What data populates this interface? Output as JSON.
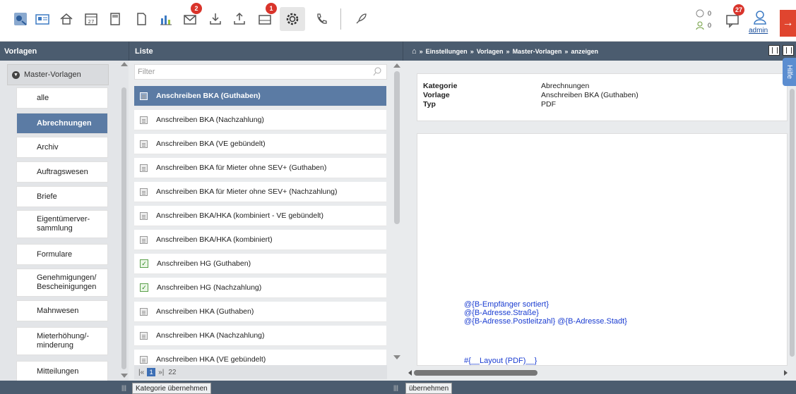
{
  "toolbar": {
    "icons": [
      "dashboard-icon",
      "contacts-icon",
      "home-icon",
      "calendar-icon",
      "calculator-icon",
      "documents-icon",
      "statistics-icon",
      "mail-icon",
      "download-icon",
      "upload-icon",
      "inbox-icon",
      "settings-icon",
      "phone-icon",
      "rocket-icon"
    ],
    "calendar_day": "27",
    "mail_badge": "2",
    "inbox_badge": "1",
    "user_count_1": "0",
    "user_count_2": "0",
    "messages_badge": "27",
    "user_label": "admin"
  },
  "headers": {
    "vorlagen": "Vorlagen",
    "liste": "Liste",
    "breadcrumb": [
      "Einstellungen",
      "Vorlagen",
      "Master-Vorlagen",
      "anzeigen"
    ]
  },
  "sidebar": {
    "root": "Master-Vorlagen",
    "items": [
      {
        "label": "alle"
      },
      {
        "label": "Abrechnungen",
        "active": true
      },
      {
        "label": "Archiv"
      },
      {
        "label": "Auftragswesen"
      },
      {
        "label": "Briefe"
      },
      {
        "label": "Eigentümerver-\nsammlung"
      },
      {
        "label": "Formulare"
      },
      {
        "label": "Genehmigungen/\nBescheinigungen"
      },
      {
        "label": "Mahnwesen"
      },
      {
        "label": "Mieterhöhung/-\nminderung"
      },
      {
        "label": "Mitteilungen"
      }
    ]
  },
  "list": {
    "filter_placeholder": "Filter",
    "items": [
      {
        "label": "Anschreiben BKA (Guthaben)",
        "icon": "doc",
        "active": true
      },
      {
        "label": "Anschreiben BKA (Nachzahlung)",
        "icon": "doc"
      },
      {
        "label": "Anschreiben BKA (VE gebündelt)",
        "icon": "doc"
      },
      {
        "label": "Anschreiben BKA für Mieter ohne SEV+ (Guthaben)",
        "icon": "doc"
      },
      {
        "label": "Anschreiben BKA für Mieter ohne SEV+ (Nachzahlung)",
        "icon": "doc"
      },
      {
        "label": "Anschreiben BKA/HKA (kombiniert - VE gebündelt)",
        "icon": "doc"
      },
      {
        "label": "Anschreiben BKA/HKA (kombiniert)",
        "icon": "doc"
      },
      {
        "label": "Anschreiben HG (Guthaben)",
        "icon": "check"
      },
      {
        "label": "Anschreiben HG (Nachzahlung)",
        "icon": "check"
      },
      {
        "label": "Anschreiben HKA (Guthaben)",
        "icon": "doc"
      },
      {
        "label": "Anschreiben HKA (Nachzahlung)",
        "icon": "doc"
      },
      {
        "label": "Anschreiben HKA (VE gebündelt)",
        "icon": "doc"
      }
    ],
    "pager_page": "1",
    "pager_total": "22"
  },
  "detail": {
    "fields": [
      {
        "key": "Kategorie",
        "value": "Abrechnungen"
      },
      {
        "key": "Vorlage",
        "value": "Anschreiben BKA (Guthaben)"
      },
      {
        "key": "Typ",
        "value": "PDF"
      }
    ],
    "preview_lines": [
      "@{B-Empfänger sortiert}",
      "@{B-Adresse.Straße}",
      "@{B-Adresse.Postleitzahl} @{B-Adresse.Stadt}",
      "#{__Layout (PDF)__}"
    ],
    "hilfe": "Hilfe"
  },
  "footer": {
    "btn_left": "Kategorie übernehmen",
    "btn_right": "übernehmen"
  }
}
